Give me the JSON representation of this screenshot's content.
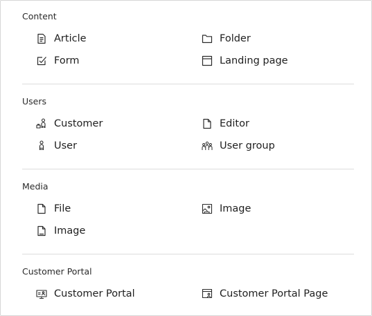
{
  "sections": [
    {
      "title": "Content",
      "items": [
        {
          "label": "Article",
          "icon": "article-icon"
        },
        {
          "label": "Folder",
          "icon": "folder-icon"
        },
        {
          "label": "Form",
          "icon": "form-checkbox-icon"
        },
        {
          "label": "Landing page",
          "icon": "landing-page-icon"
        }
      ]
    },
    {
      "title": "Users",
      "items": [
        {
          "label": "Customer",
          "icon": "customer-icon"
        },
        {
          "label": "Editor",
          "icon": "editor-file-icon"
        },
        {
          "label": "User",
          "icon": "user-icon"
        },
        {
          "label": "User group",
          "icon": "user-group-icon"
        }
      ]
    },
    {
      "title": "Media",
      "items": [
        {
          "label": "File",
          "icon": "file-icon"
        },
        {
          "label": "Image",
          "icon": "image-icon"
        },
        {
          "label": "Image",
          "icon": "image-file-icon"
        }
      ]
    },
    {
      "title": "Customer Portal",
      "items": [
        {
          "label": "Customer Portal",
          "icon": "customer-portal-icon"
        },
        {
          "label": "Customer Portal Page",
          "icon": "customer-portal-page-icon"
        }
      ]
    }
  ]
}
